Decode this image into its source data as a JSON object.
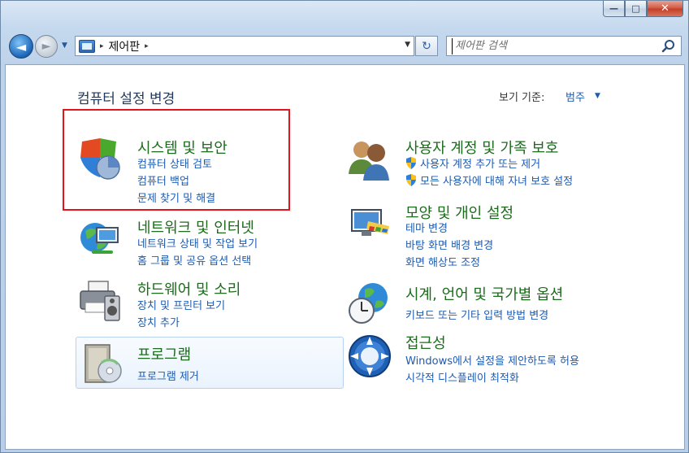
{
  "window": {
    "minimize_label": "—",
    "maximize_label": "□",
    "close_label": "✕"
  },
  "nav": {
    "back_glyph": "◄",
    "forward_glyph": "►",
    "recent_glyph": "▼",
    "address_path": "제어판",
    "path_separator": "▸",
    "dropdown_glyph": "▼",
    "refresh_glyph": "↻"
  },
  "search": {
    "placeholder": "제어판 검색"
  },
  "main": {
    "title": "컴퓨터 설정 변경",
    "view_by_label": "보기 기준:",
    "view_by_value": "범주",
    "view_by_caret": "▼"
  },
  "categories": [
    {
      "title": "시스템 및 보안",
      "icon": "system-security-icon",
      "links": [
        "컴퓨터 상태 검토",
        "컴퓨터 백업",
        "문제 찾기 및 해결"
      ]
    },
    {
      "title": "네트워크 및 인터넷",
      "icon": "network-internet-icon",
      "links": [
        "네트워크 상태 및 작업 보기",
        "홈 그룹 및 공유 옵션 선택"
      ]
    },
    {
      "title": "하드웨어 및 소리",
      "icon": "hardware-sound-icon",
      "links": [
        "장치 및 프린터 보기",
        "장치 추가"
      ]
    },
    {
      "title": "프로그램",
      "icon": "programs-icon",
      "links": [
        "프로그램 제거"
      ]
    },
    {
      "title": "사용자 계정 및 가족 보호",
      "icon": "user-accounts-icon",
      "links": [
        "사용자 계정 추가 또는 제거",
        "모든 사용자에 대해 자녀 보호 설정"
      ]
    },
    {
      "title": "모양 및 개인 설정",
      "icon": "appearance-icon",
      "links": [
        "테마 변경",
        "바탕 화면 배경 변경",
        "화면 해상도 조정"
      ]
    },
    {
      "title": "시계, 언어 및 국가별 옵션",
      "icon": "clock-language-region-icon",
      "links": [
        "키보드 또는 기타 입력 방법 변경"
      ]
    },
    {
      "title": "접근성",
      "icon": "ease-of-access-icon",
      "links": [
        "Windows에서 설정을 제안하도록 허용",
        "시각적 디스플레이 최적화"
      ]
    }
  ],
  "colors": {
    "category_title": "#1c6b1c",
    "link": "#1e5bb0",
    "highlight_border": "#e3151a"
  }
}
